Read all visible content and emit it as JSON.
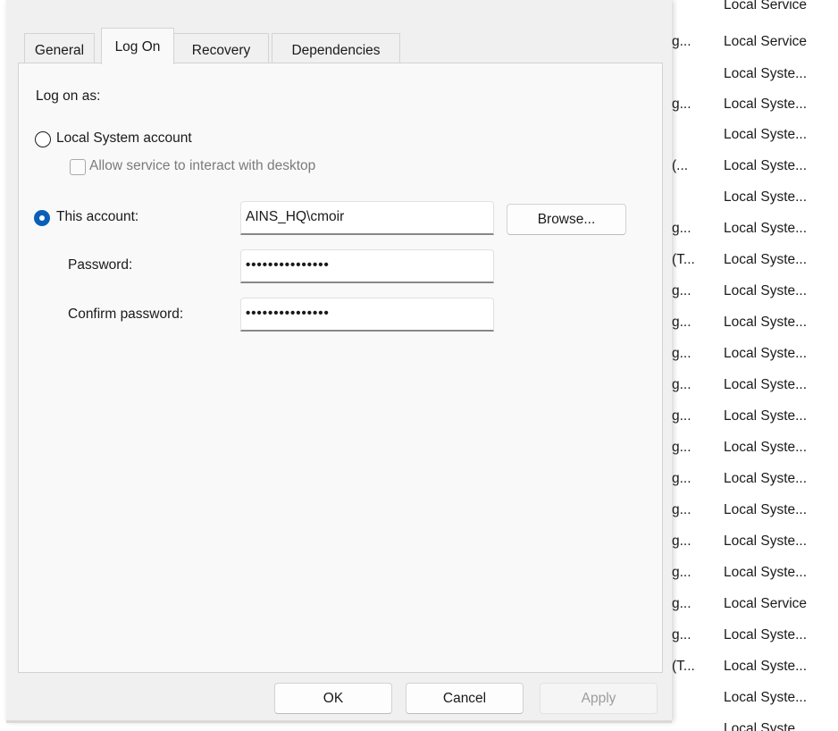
{
  "background_list": {
    "rows": [
      {
        "col1": "",
        "col2": "Local Service"
      },
      {
        "col1": "g...",
        "col2": "Local Service"
      },
      {
        "col1": "",
        "col2": "Local Syste..."
      },
      {
        "col1": "g...",
        "col2": "Local Syste..."
      },
      {
        "col1": "",
        "col2": "Local Syste..."
      },
      {
        "col1": "(...",
        "col2": "Local Syste..."
      },
      {
        "col1": "",
        "col2": "Local Syste..."
      },
      {
        "col1": "g...",
        "col2": "Local Syste..."
      },
      {
        "col1": "(T...",
        "col2": "Local Syste..."
      },
      {
        "col1": "g...",
        "col2": "Local Syste..."
      },
      {
        "col1": "g...",
        "col2": "Local Syste..."
      },
      {
        "col1": "g...",
        "col2": "Local Syste..."
      },
      {
        "col1": "g...",
        "col2": "Local Syste..."
      },
      {
        "col1": "g...",
        "col2": "Local Syste..."
      },
      {
        "col1": "g...",
        "col2": "Local Syste..."
      },
      {
        "col1": "g...",
        "col2": "Local Syste..."
      },
      {
        "col1": "g...",
        "col2": "Local Syste..."
      },
      {
        "col1": "g...",
        "col2": "Local Syste..."
      },
      {
        "col1": "g...",
        "col2": "Local Syste..."
      },
      {
        "col1": "g...",
        "col2": "Local Service"
      },
      {
        "col1": "g...",
        "col2": "Local Syste..."
      },
      {
        "col1": "(T...",
        "col2": "Local Syste..."
      },
      {
        "col1": "",
        "col2": "Local Syste..."
      },
      {
        "col1": "",
        "col2": "Local Syste..."
      }
    ]
  },
  "dialog": {
    "tabs": [
      "General",
      "Log On",
      "Recovery",
      "Dependencies"
    ],
    "active_tab": "Log On",
    "logon": {
      "log_on_as_label": "Log on as:",
      "local_system_label": "Local System account",
      "local_system_selected": false,
      "interact_desktop_label": "Allow service to interact with desktop",
      "interact_desktop_checked": false,
      "this_account_label": "This account:",
      "this_account_selected": true,
      "account_value": "AINS_HQ\\cmoir",
      "browse_label": "Browse...",
      "password_label": "Password:",
      "password_value": "•••••••••••••••",
      "confirm_label": "Confirm password:",
      "confirm_value": "•••••••••••••••"
    },
    "buttons": {
      "ok": "OK",
      "cancel": "Cancel",
      "apply": "Apply"
    }
  },
  "colors": {
    "radio_selected": "#0a5fb8",
    "dialog_background": "#f0f0f0",
    "panel_background": "#f9f9f9"
  }
}
